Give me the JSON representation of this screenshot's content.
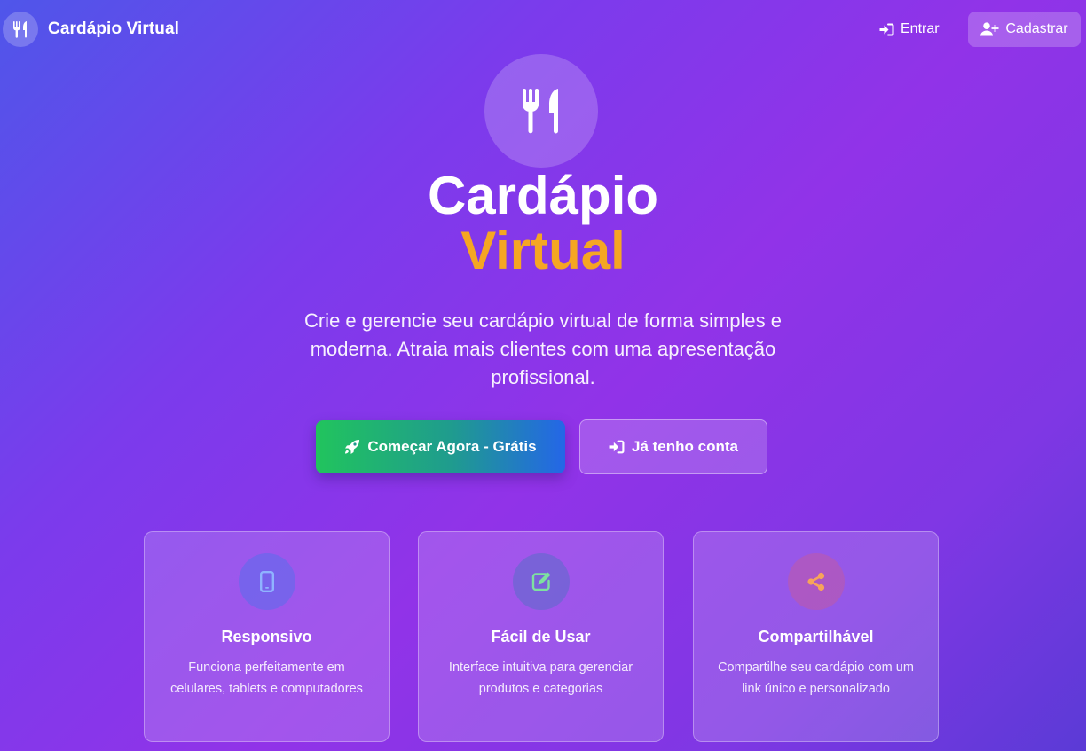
{
  "header": {
    "brand_title": "Cardápio Virtual",
    "login_label": "Entrar",
    "register_label": "Cadastrar"
  },
  "hero": {
    "title_line1": "Cardápio",
    "title_line2": "Virtual",
    "subtitle": "Crie e gerencie seu cardápio virtual de forma simples e moderna. Atraia mais clientes com uma apresentação profissional.",
    "primary_button": "Começar Agora - Grátis",
    "secondary_button": "Já tenho conta"
  },
  "features": [
    {
      "icon": "mobile-icon",
      "title": "Responsivo",
      "description": "Funciona perfeitamente em celulares, tablets e computadores"
    },
    {
      "icon": "edit-icon",
      "title": "Fácil de Usar",
      "description": "Interface intuitiva para gerenciar produtos e categorias"
    },
    {
      "icon": "share-icon",
      "title": "Compartilhável",
      "description": "Compartilhe seu cardápio com um link único e personalizado"
    }
  ],
  "colors": {
    "accent_orange": "#f5a623",
    "green": "#21c45d",
    "blue": "#2466e8",
    "background_start": "#4f56ea",
    "background_mid": "#9133e8"
  }
}
